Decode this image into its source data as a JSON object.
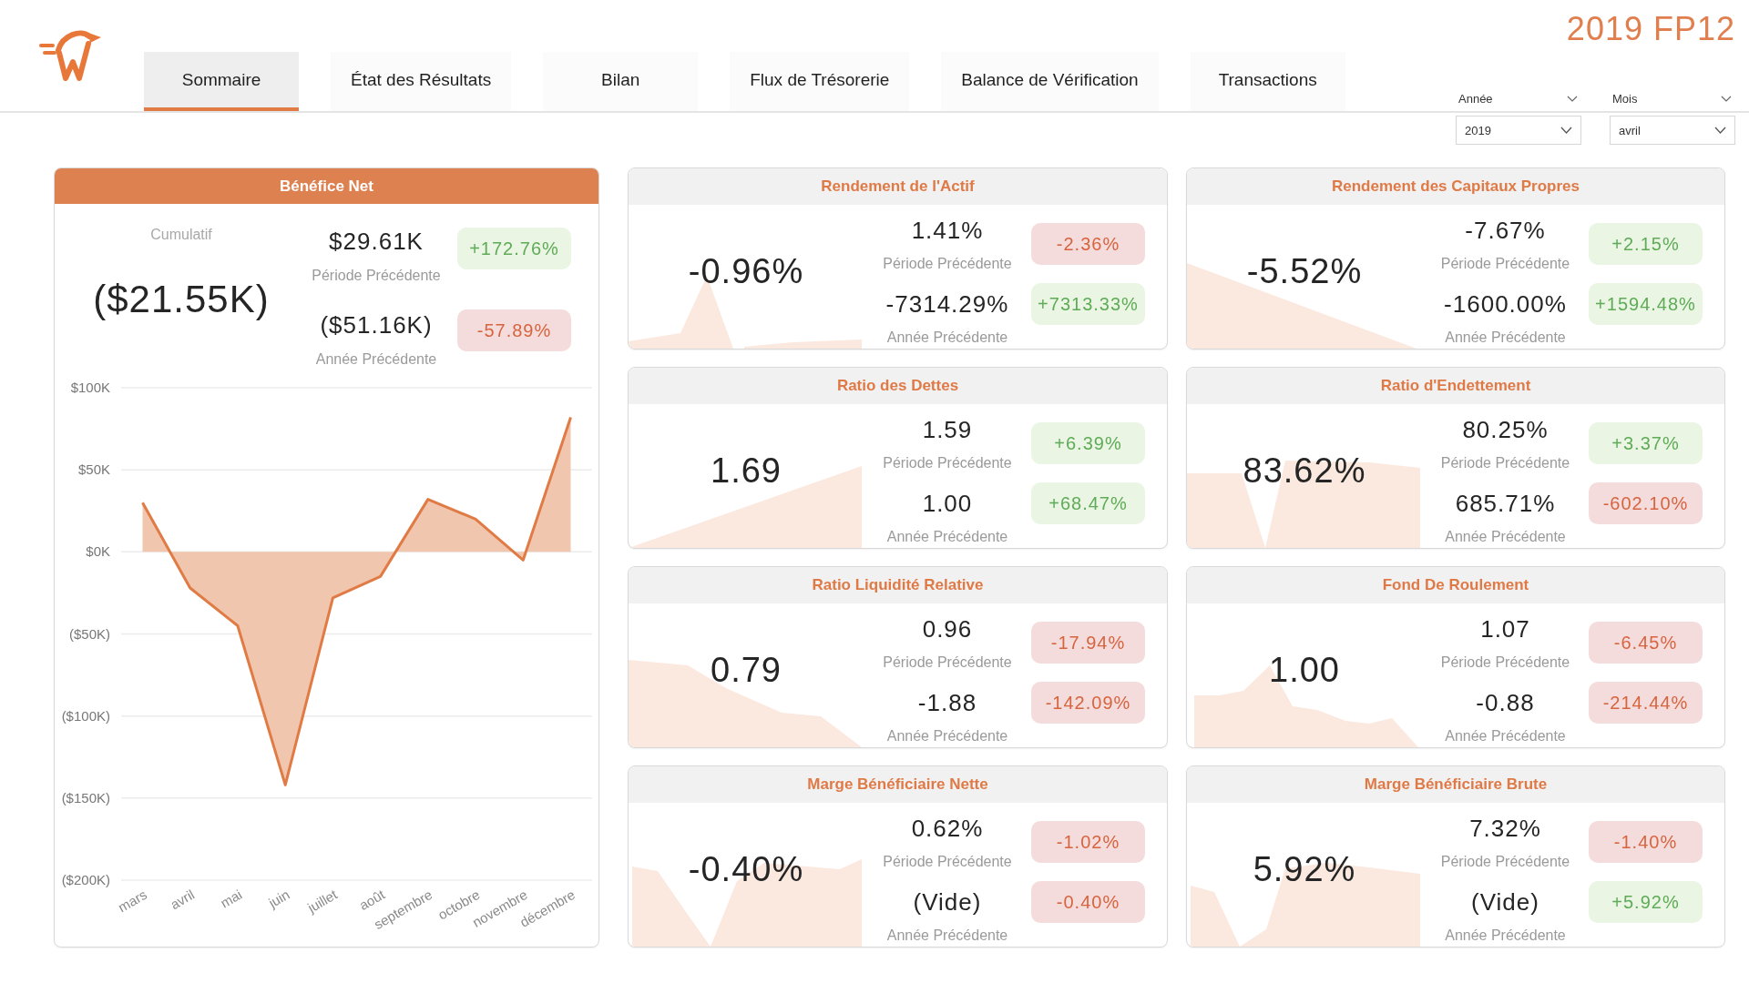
{
  "tabs": [
    {
      "label": "Sommaire",
      "selected": true
    },
    {
      "label": "État des Résultats",
      "selected": false
    },
    {
      "label": "Bilan",
      "selected": false
    },
    {
      "label": "Flux de Trésorerie",
      "selected": false
    },
    {
      "label": "Balance de Vérification",
      "selected": false
    },
    {
      "label": "Transactions",
      "selected": false
    }
  ],
  "report_title": "2019 FP12",
  "slicers": [
    {
      "title": "Année",
      "value": "2019"
    },
    {
      "title": "Mois",
      "value": "avril"
    }
  ],
  "net_income": {
    "title": "Bénéfice Net",
    "caption": "Cumulatif",
    "value": "($21.55K)",
    "comparisons": [
      {
        "value": "$29.61K",
        "label": "Période Précédente",
        "change": "+172.76%",
        "positive": true
      },
      {
        "value": "($51.16K)",
        "label": "Année Précédente",
        "change": "-57.89%",
        "positive": false
      }
    ],
    "chart_data": {
      "type": "area",
      "categories": [
        "mars",
        "avril",
        "mai",
        "juin",
        "juillet",
        "août",
        "septembre",
        "octobre",
        "novembre",
        "décembre"
      ],
      "values": [
        30000,
        -22000,
        -45000,
        -142000,
        -28000,
        -15000,
        32000,
        20000,
        -5000,
        82000
      ],
      "ylim": [
        -200000,
        100000
      ],
      "yticks": [
        {
          "value": 100000,
          "label": "$100K"
        },
        {
          "value": 50000,
          "label": "$50K"
        },
        {
          "value": 0,
          "label": "$0K"
        },
        {
          "value": -50000,
          "label": "($50K)"
        },
        {
          "value": -100000,
          "label": "($100K)"
        },
        {
          "value": -150000,
          "label": "($150K)"
        },
        {
          "value": -200000,
          "label": "($200K)"
        }
      ],
      "grid": true
    }
  },
  "kpis": [
    {
      "title": "Rendement de l'Actif",
      "value": "-0.96%",
      "comparisons": [
        {
          "value": "1.41%",
          "label": "Période Précédente",
          "change": "-2.36%",
          "positive": false
        },
        {
          "value": "-7314.29%",
          "label": "Année Précédente",
          "change": "+7313.33%",
          "positive": true
        }
      ]
    },
    {
      "title": "Rendement des Capitaux Propres",
      "value": "-5.52%",
      "comparisons": [
        {
          "value": "-7.67%",
          "label": "Période Précédente",
          "change": "+2.15%",
          "positive": true
        },
        {
          "value": "-1600.00%",
          "label": "Année Précédente",
          "change": "+1594.48%",
          "positive": true
        }
      ]
    },
    {
      "title": "Ratio des Dettes",
      "value": "1.69",
      "comparisons": [
        {
          "value": "1.59",
          "label": "Période Précédente",
          "change": "+6.39%",
          "positive": true
        },
        {
          "value": "1.00",
          "label": "Année Précédente",
          "change": "+68.47%",
          "positive": true
        }
      ]
    },
    {
      "title": "Ratio d'Endettement",
      "value": "83.62%",
      "comparisons": [
        {
          "value": "80.25%",
          "label": "Période Précédente",
          "change": "+3.37%",
          "positive": true
        },
        {
          "value": "685.71%",
          "label": "Année Précédente",
          "change": "-602.10%",
          "positive": false
        }
      ]
    },
    {
      "title": "Ratio Liquidité Relative",
      "value": "0.79",
      "comparisons": [
        {
          "value": "0.96",
          "label": "Période Précédente",
          "change": "-17.94%",
          "positive": false
        },
        {
          "value": "-1.88",
          "label": "Année Précédente",
          "change": "-142.09%",
          "positive": false
        }
      ]
    },
    {
      "title": "Fond De Roulement",
      "value": "1.00",
      "comparisons": [
        {
          "value": "1.07",
          "label": "Période Précédente",
          "change": "-6.45%",
          "positive": false
        },
        {
          "value": "-0.88",
          "label": "Année Précédente",
          "change": "-214.44%",
          "positive": false
        }
      ]
    },
    {
      "title": "Marge Bénéficiaire Nette",
      "value": "-0.40%",
      "comparisons": [
        {
          "value": "0.62%",
          "label": "Période Précédente",
          "change": "-1.02%",
          "positive": false
        },
        {
          "value": "(Vide)",
          "label": "Année Précédente",
          "change": "-0.40%",
          "positive": false
        }
      ]
    },
    {
      "title": "Marge Bénéficiaire Brute",
      "value": "5.92%",
      "comparisons": [
        {
          "value": "7.32%",
          "label": "Période Précédente",
          "change": "-1.40%",
          "positive": false
        },
        {
          "value": "(Vide)",
          "label": "Année Précédente",
          "change": "+5.92%",
          "positive": true
        }
      ]
    }
  ]
}
